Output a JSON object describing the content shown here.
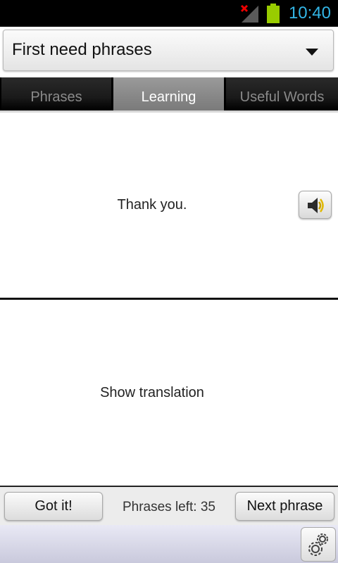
{
  "status_bar": {
    "time": "10:40",
    "icons": [
      "signal-no-service-icon",
      "battery-icon"
    ],
    "time_color": "#33b5e5",
    "battery_color": "#99cc00"
  },
  "category_spinner": {
    "selected": "First need phrases"
  },
  "tabs": [
    {
      "label": "Phrases",
      "active": false
    },
    {
      "label": "Learning",
      "active": true
    },
    {
      "label": "Useful Words",
      "active": false
    }
  ],
  "phrase_card": {
    "text": "Thank you.",
    "speak_icon": "speaker-icon"
  },
  "translation_card": {
    "text": "Show translation"
  },
  "bottom_bar": {
    "got_it_label": "Got it!",
    "phrases_left": "Phrases left: 35",
    "next_label": "Next phrase"
  },
  "footer": {
    "settings_icon": "gears-icon"
  }
}
